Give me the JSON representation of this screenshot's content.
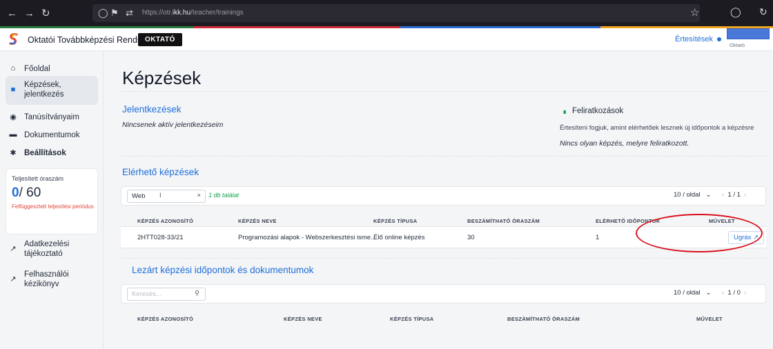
{
  "browser": {
    "url_prefix": "https://otr.",
    "url_domain": "ikk.hu",
    "url_path": "/teacher/trainings"
  },
  "header": {
    "app_title": "Oktatói Továbbképzési Rendszer",
    "role_badge": "OKTATÓ",
    "notifications_label": "Értesítések",
    "user_role": "Oktató"
  },
  "sidebar": {
    "items": [
      {
        "label": "Főoldal",
        "icon": "home-icon"
      },
      {
        "label": "Képzések, jelentkezés",
        "icon": "book-icon"
      },
      {
        "label": "Tanúsítványaim",
        "icon": "certificate-icon"
      },
      {
        "label": "Dokumentumok",
        "icon": "folder-icon"
      },
      {
        "label": "Beállítások",
        "icon": "gear-icon"
      },
      {
        "label": "Adatkezelési tájékoztató",
        "icon": "external-link-icon"
      },
      {
        "label": "Felhasználói kézikönyv",
        "icon": "external-link-icon"
      }
    ],
    "stat": {
      "title": "Teljesített óraszám",
      "done": "0",
      "total": "/ 60",
      "warning": "Felfüggesztett teljesítési periódus"
    }
  },
  "main": {
    "title": "Képzések",
    "applications": {
      "heading": "Jelentkezések",
      "empty": "Nincsenek aktív jelentkezéseim"
    },
    "subscriptions": {
      "heading": "Feliratkozások",
      "note": "Értesíteni fogjuk, amint elérhetőek lesznek új időpontok a képzésre",
      "empty": "Nincs olyan képzés, melyre feliratkozott."
    },
    "available": {
      "heading": "Elérhető képzések",
      "search_value": "Web",
      "clear": "×",
      "result_count": "1 db találat",
      "page_size": "10 / oldal",
      "pager": "1 / 1",
      "columns": [
        "KÉPZÉS AZONOSÍTÓ",
        "KÉPZÉS NEVE",
        "KÉPZÉS TÍPUSA",
        "BESZÁMÍTHATÓ ÓRASZÁM",
        "ELÉRHETŐ IDŐPONTOK",
        "MŰVELET"
      ],
      "rows": [
        {
          "id": "2HTT028-33/21",
          "name": "Programozási alapok - Webszerkesztési isme...",
          "type": "Élő online képzés",
          "hours": "30",
          "slots": "1",
          "action": "Ugrás ↗"
        }
      ]
    },
    "closed": {
      "heading": "Lezárt képzési időpontok és dokumentumok",
      "search_placeholder": "Keresés...",
      "page_size": "10 / oldal",
      "pager": "1 / 0",
      "columns": [
        "KÉPZÉS AZONOSÍTÓ",
        "KÉPZÉS NEVE",
        "KÉPZÉS TÍPUSA",
        "BESZÁMÍTHATÓ ÓRASZÁM",
        "MŰVELET"
      ]
    }
  },
  "colors": {
    "accent": "#1e6fd9",
    "warning": "#e0453a",
    "annotation": "#d90f1b"
  }
}
